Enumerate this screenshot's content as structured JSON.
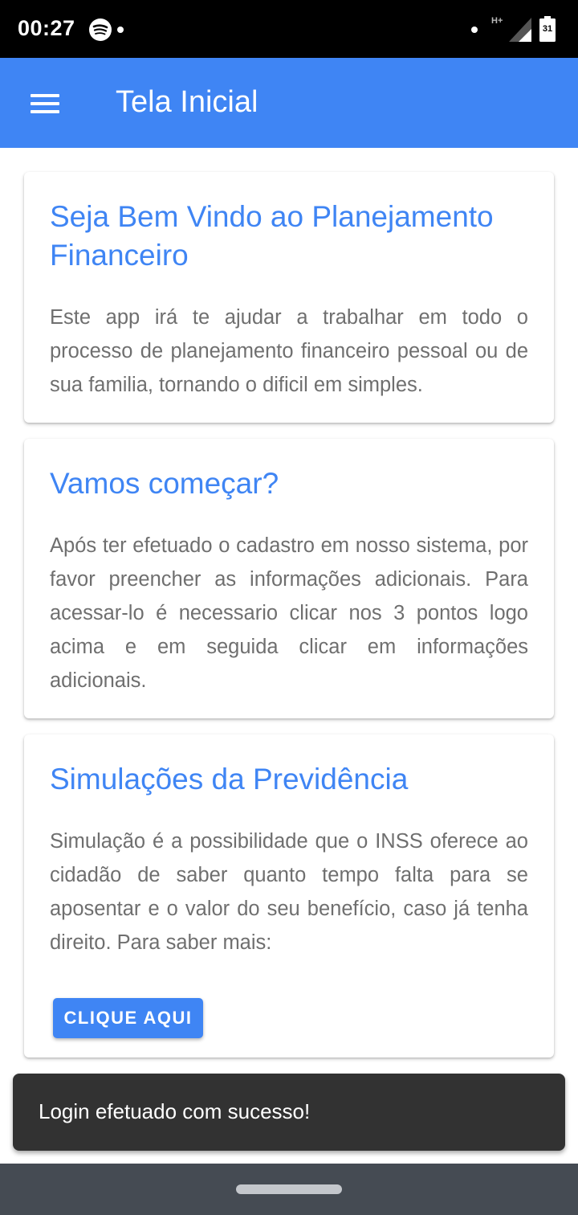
{
  "status_bar": {
    "time": "00:27",
    "network": "H+",
    "battery": "31",
    "icons": [
      "spotify-icon",
      "signal-icon",
      "battery-icon"
    ]
  },
  "app_bar": {
    "title": "Tela Inicial",
    "menu_icon": "hamburger-menu-icon",
    "color": "#3f85f4"
  },
  "cards": [
    {
      "title": "Seja Bem Vindo ao Planejamento Financeiro",
      "text": "Este app irá te ajudar a trabalhar em todo o processo de planejamento financeiro pessoal ou de sua familia, tornando o dificil em simples."
    },
    {
      "title": "Vamos começar?",
      "text": "Após ter efetuado o cadastro em nosso sistema, por favor preencher as informações adicionais. Para acessar-lo é necessario clicar nos 3 pontos logo acima e em seguida clicar em informações adicionais."
    },
    {
      "title": "Simulações da Previdência",
      "text": "Simulação é a possibilidade que o INSS oferece ao cidadão de saber quanto tempo falta para se aposentar e o valor do seu benefício, caso já tenha direito. Para saber mais:",
      "button_label": "CLIQUE AQUI"
    }
  ],
  "snackbar": {
    "message": "Login efetuado com sucesso!"
  },
  "colors": {
    "primary": "#3f85f4",
    "text_secondary": "#6f6f6f",
    "snackbar_bg": "#323232",
    "nav_bar": "#454b53"
  }
}
